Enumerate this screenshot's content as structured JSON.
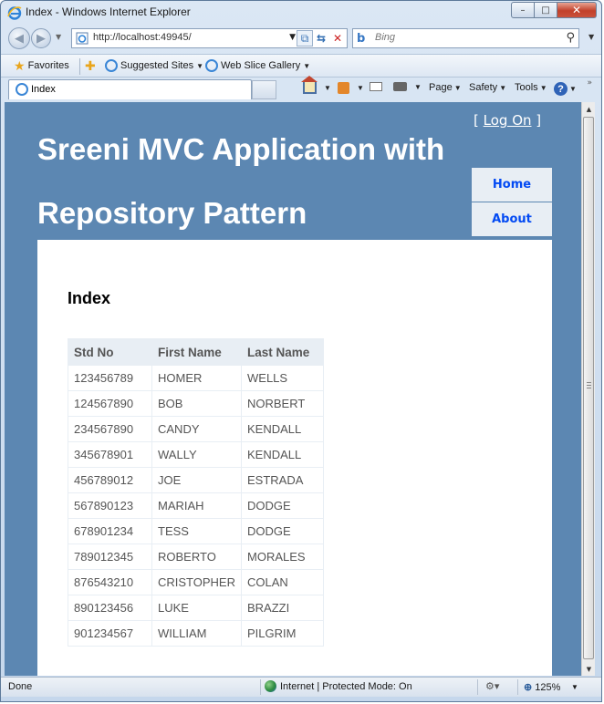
{
  "window": {
    "title": "Index - Windows Internet Explorer",
    "controls": {
      "minimize": "–",
      "maximize": "□",
      "close": "✕"
    }
  },
  "navigation": {
    "back_icon": "back-arrow-icon",
    "forward_icon": "forward-arrow-icon",
    "address": "http://localhost:49945/",
    "search_placeholder": "Bing"
  },
  "favorites_bar": {
    "favorites_label": "Favorites",
    "items": [
      {
        "label": "Suggested Sites"
      },
      {
        "label": "Web Slice Gallery"
      }
    ]
  },
  "tab": {
    "label": "Index"
  },
  "command_bar": {
    "page_label": "Page",
    "safety_label": "Safety",
    "tools_label": "Tools",
    "help_glyph": "?"
  },
  "site": {
    "login": {
      "bracket_open": "[",
      "link_label": "Log On",
      "bracket_close": "]"
    },
    "title": "Sreeni MVC Application with Repository Pattern",
    "menu": [
      {
        "label": "Home"
      },
      {
        "label": "About"
      }
    ],
    "page_heading": "Index",
    "table": {
      "headers": [
        "Std No",
        "First Name",
        "Last Name"
      ],
      "rows": [
        [
          "123456789",
          "HOMER",
          "WELLS"
        ],
        [
          "124567890",
          "BOB",
          "NORBERT"
        ],
        [
          "234567890",
          "CANDY",
          "KENDALL"
        ],
        [
          "345678901",
          "WALLY",
          "KENDALL"
        ],
        [
          "456789012",
          "JOE",
          "ESTRADA"
        ],
        [
          "567890123",
          "MARIAH",
          "DODGE"
        ],
        [
          "678901234",
          "TESS",
          "DODGE"
        ],
        [
          "789012345",
          "ROBERTO",
          "MORALES"
        ],
        [
          "876543210",
          "CRISTOPHER",
          "COLAN"
        ],
        [
          "890123456",
          "LUKE",
          "BRAZZI"
        ],
        [
          "901234567",
          "WILLIAM",
          "PILGRIM"
        ]
      ]
    },
    "colors": {
      "page_background": "#5c87b2",
      "menu_background": "#e8eef4",
      "menu_text": "#034af3",
      "header_text": "#ffffff"
    }
  },
  "status_bar": {
    "status": "Done",
    "zone": "Internet | Protected Mode: On",
    "zoom": "125%"
  }
}
